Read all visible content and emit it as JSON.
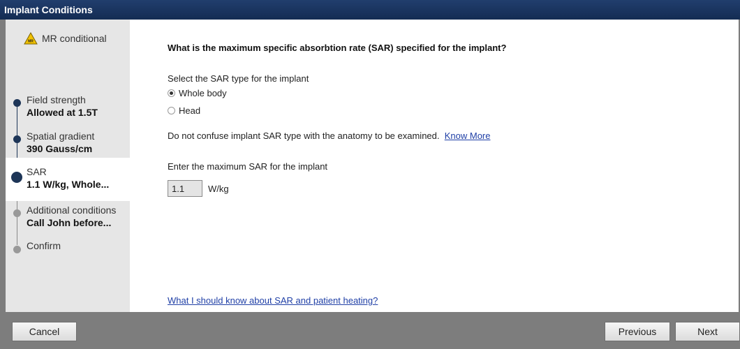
{
  "window": {
    "title": "Implant Conditions"
  },
  "sidebar": {
    "status": {
      "icon": "mr-conditional-warning-icon",
      "label": "MR conditional",
      "icon_text": "MR"
    },
    "steps": [
      {
        "label": "Field strength",
        "value": "Allowed at 1.5T",
        "state": "done"
      },
      {
        "label": "Spatial gradient",
        "value": "390 Gauss/cm",
        "state": "done"
      },
      {
        "label": "SAR",
        "value": "1.1 W/kg, Whole...",
        "state": "current"
      },
      {
        "label": "Additional conditions",
        "value": "Call John before...",
        "state": "pending"
      },
      {
        "label": "Confirm",
        "value": "",
        "state": "pending"
      }
    ]
  },
  "main": {
    "question": "What is the maximum specific absorbtion rate (SAR) specified for the implant?",
    "sar_type_prompt": "Select the SAR type for the implant",
    "sar_type_options": [
      {
        "label": "Whole body",
        "selected": true
      },
      {
        "label": "Head",
        "selected": false
      }
    ],
    "warning_text": "Do not confuse implant SAR type with the anatomy to be examined.",
    "know_more_link": "Know More",
    "max_sar_prompt": "Enter the maximum SAR for the implant",
    "max_sar_value": "1.1",
    "max_sar_unit": "W/kg",
    "help_link": "What I should know about SAR and patient heating?"
  },
  "footer": {
    "cancel_label": "Cancel",
    "previous_label": "Previous",
    "next_label": "Next"
  },
  "colors": {
    "title_bar": "#1b355f",
    "step_done": "#1d3557",
    "step_pending": "#999999",
    "warning_icon": "#f2c200",
    "link": "#1f3fa6"
  }
}
